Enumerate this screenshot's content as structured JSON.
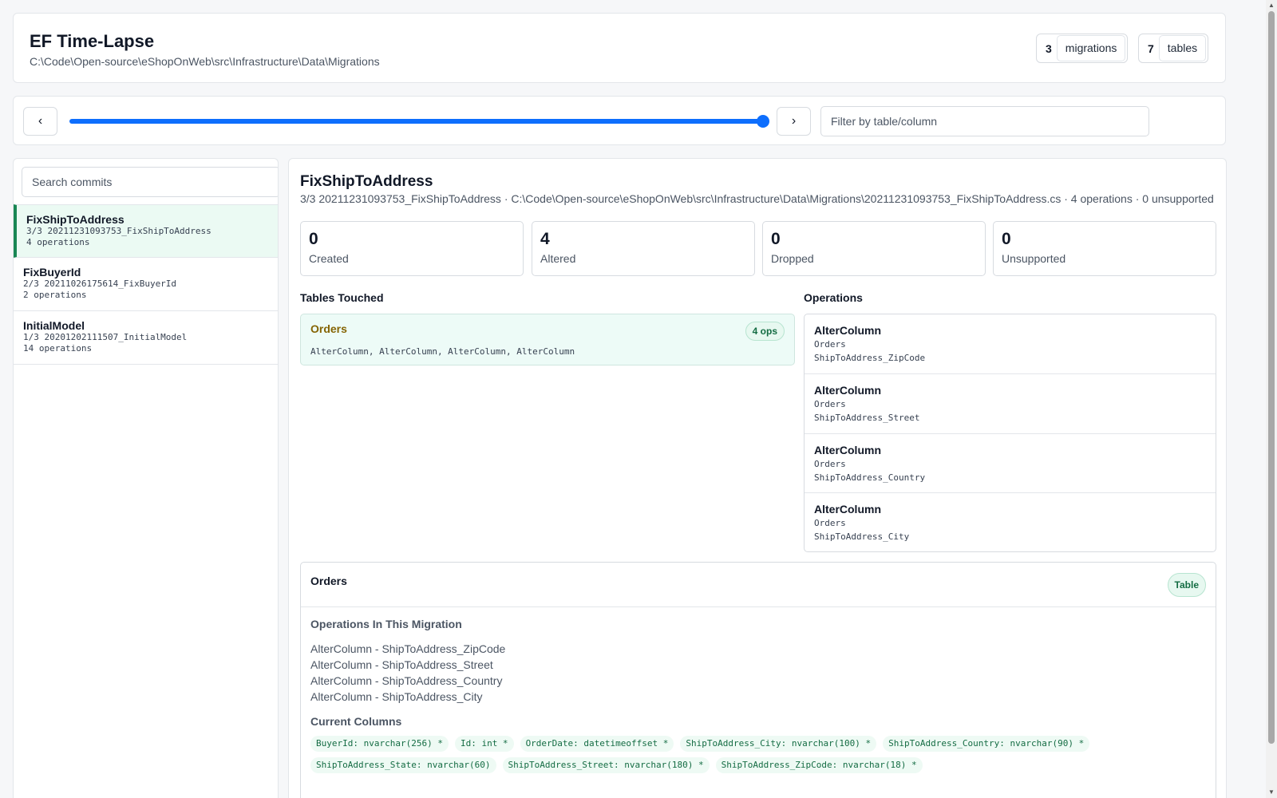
{
  "header": {
    "title": "EF Time-Lapse",
    "path": "C:\\Code\\Open-source\\eShopOnWeb\\src\\Infrastructure\\Data\\Migrations",
    "stats": [
      {
        "num": "3",
        "label": "migrations"
      },
      {
        "num": "7",
        "label": "tables"
      }
    ]
  },
  "timeline": {
    "prev_label": "‹",
    "next_label": "›",
    "position": 3,
    "total": 3,
    "filter_placeholder": "Filter by table/column",
    "accent": "#0d6efd"
  },
  "sidebar": {
    "search_placeholder": "Search commits",
    "commits": [
      {
        "name": "FixShipToAddress",
        "id_line": "3/3 20211231093753_FixShipToAddress",
        "ops": "4 operations",
        "active": true
      },
      {
        "name": "FixBuyerId",
        "id_line": "2/3 20211026175614_FixBuyerId",
        "ops": "2 operations",
        "active": false
      },
      {
        "name": "InitialModel",
        "id_line": "1/3 20201202111507_InitialModel",
        "ops": "14 operations",
        "active": false
      }
    ]
  },
  "migration": {
    "title": "FixShipToAddress",
    "subtitle": "3/3 20211231093753_FixShipToAddress · C:\\Code\\Open-source\\eShopOnWeb\\src\\Infrastructure\\Data\\Migrations\\20211231093753_FixShipToAddress.cs · 4 operations · 0 unsupported",
    "metrics": [
      {
        "num": "0",
        "label": "Created"
      },
      {
        "num": "4",
        "label": "Altered"
      },
      {
        "num": "0",
        "label": "Dropped"
      },
      {
        "num": "0",
        "label": "Unsupported"
      }
    ],
    "tables_touched_heading": "Tables Touched",
    "operations_heading": "Operations",
    "touched": {
      "name": "Orders",
      "badge": "4 ops",
      "ops": "AlterColumn, AlterColumn, AlterColumn, AlterColumn"
    },
    "operations": [
      {
        "kind": "AlterColumn",
        "table": "Orders",
        "column": "ShipToAddress_ZipCode"
      },
      {
        "kind": "AlterColumn",
        "table": "Orders",
        "column": "ShipToAddress_Street"
      },
      {
        "kind": "AlterColumn",
        "table": "Orders",
        "column": "ShipToAddress_Country"
      },
      {
        "kind": "AlterColumn",
        "table": "Orders",
        "column": "ShipToAddress_City"
      }
    ]
  },
  "table_detail": {
    "name": "Orders",
    "badge": "Table",
    "ops_heading": "Operations In This Migration",
    "ops": [
      "AlterColumn - ShipToAddress_ZipCode",
      "AlterColumn - ShipToAddress_Street",
      "AlterColumn - ShipToAddress_Country",
      "AlterColumn - ShipToAddress_City"
    ],
    "columns_heading": "Current Columns",
    "columns": [
      "BuyerId: nvarchar(256) *",
      "Id: int *",
      "OrderDate: datetimeoffset *",
      "ShipToAddress_City: nvarchar(100) *",
      "ShipToAddress_Country: nvarchar(90) *",
      "ShipToAddress_State: nvarchar(60)",
      "ShipToAddress_Street: nvarchar(180) *",
      "ShipToAddress_ZipCode: nvarchar(18) *"
    ]
  }
}
